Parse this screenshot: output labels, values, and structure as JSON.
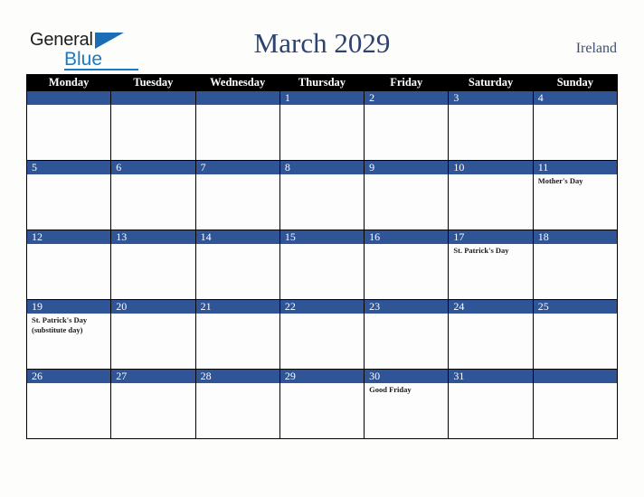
{
  "logo": {
    "text_primary": "General",
    "text_secondary": "Blue",
    "triangle_icon": "triangle-icon"
  },
  "header": {
    "title": "March 2029",
    "country": "Ireland"
  },
  "colors": {
    "day_bar_blue": "#2f5596",
    "header_black": "#000000",
    "title_navy": "#2e4270",
    "country_navy": "#3d4f72",
    "logo_blue": "#1b7ac4",
    "page_background": "#fdfdfb"
  },
  "calendar": {
    "weekday_headers": [
      "Monday",
      "Tuesday",
      "Wednesday",
      "Thursday",
      "Friday",
      "Saturday",
      "Sunday"
    ],
    "weeks": [
      [
        {
          "day": "",
          "events": []
        },
        {
          "day": "",
          "events": []
        },
        {
          "day": "",
          "events": []
        },
        {
          "day": "1",
          "events": []
        },
        {
          "day": "2",
          "events": []
        },
        {
          "day": "3",
          "events": []
        },
        {
          "day": "4",
          "events": []
        }
      ],
      [
        {
          "day": "5",
          "events": []
        },
        {
          "day": "6",
          "events": []
        },
        {
          "day": "7",
          "events": []
        },
        {
          "day": "8",
          "events": []
        },
        {
          "day": "9",
          "events": []
        },
        {
          "day": "10",
          "events": []
        },
        {
          "day": "11",
          "events": [
            "Mother's Day"
          ]
        }
      ],
      [
        {
          "day": "12",
          "events": []
        },
        {
          "day": "13",
          "events": []
        },
        {
          "day": "14",
          "events": []
        },
        {
          "day": "15",
          "events": []
        },
        {
          "day": "16",
          "events": []
        },
        {
          "day": "17",
          "events": [
            "St. Patrick's Day"
          ]
        },
        {
          "day": "18",
          "events": []
        }
      ],
      [
        {
          "day": "19",
          "events": [
            "St. Patrick's Day",
            "(substitute day)"
          ]
        },
        {
          "day": "20",
          "events": []
        },
        {
          "day": "21",
          "events": []
        },
        {
          "day": "22",
          "events": []
        },
        {
          "day": "23",
          "events": []
        },
        {
          "day": "24",
          "events": []
        },
        {
          "day": "25",
          "events": []
        }
      ],
      [
        {
          "day": "26",
          "events": []
        },
        {
          "day": "27",
          "events": []
        },
        {
          "day": "28",
          "events": []
        },
        {
          "day": "29",
          "events": []
        },
        {
          "day": "30",
          "events": [
            "Good Friday"
          ]
        },
        {
          "day": "31",
          "events": []
        },
        {
          "day": "",
          "events": []
        }
      ]
    ]
  }
}
